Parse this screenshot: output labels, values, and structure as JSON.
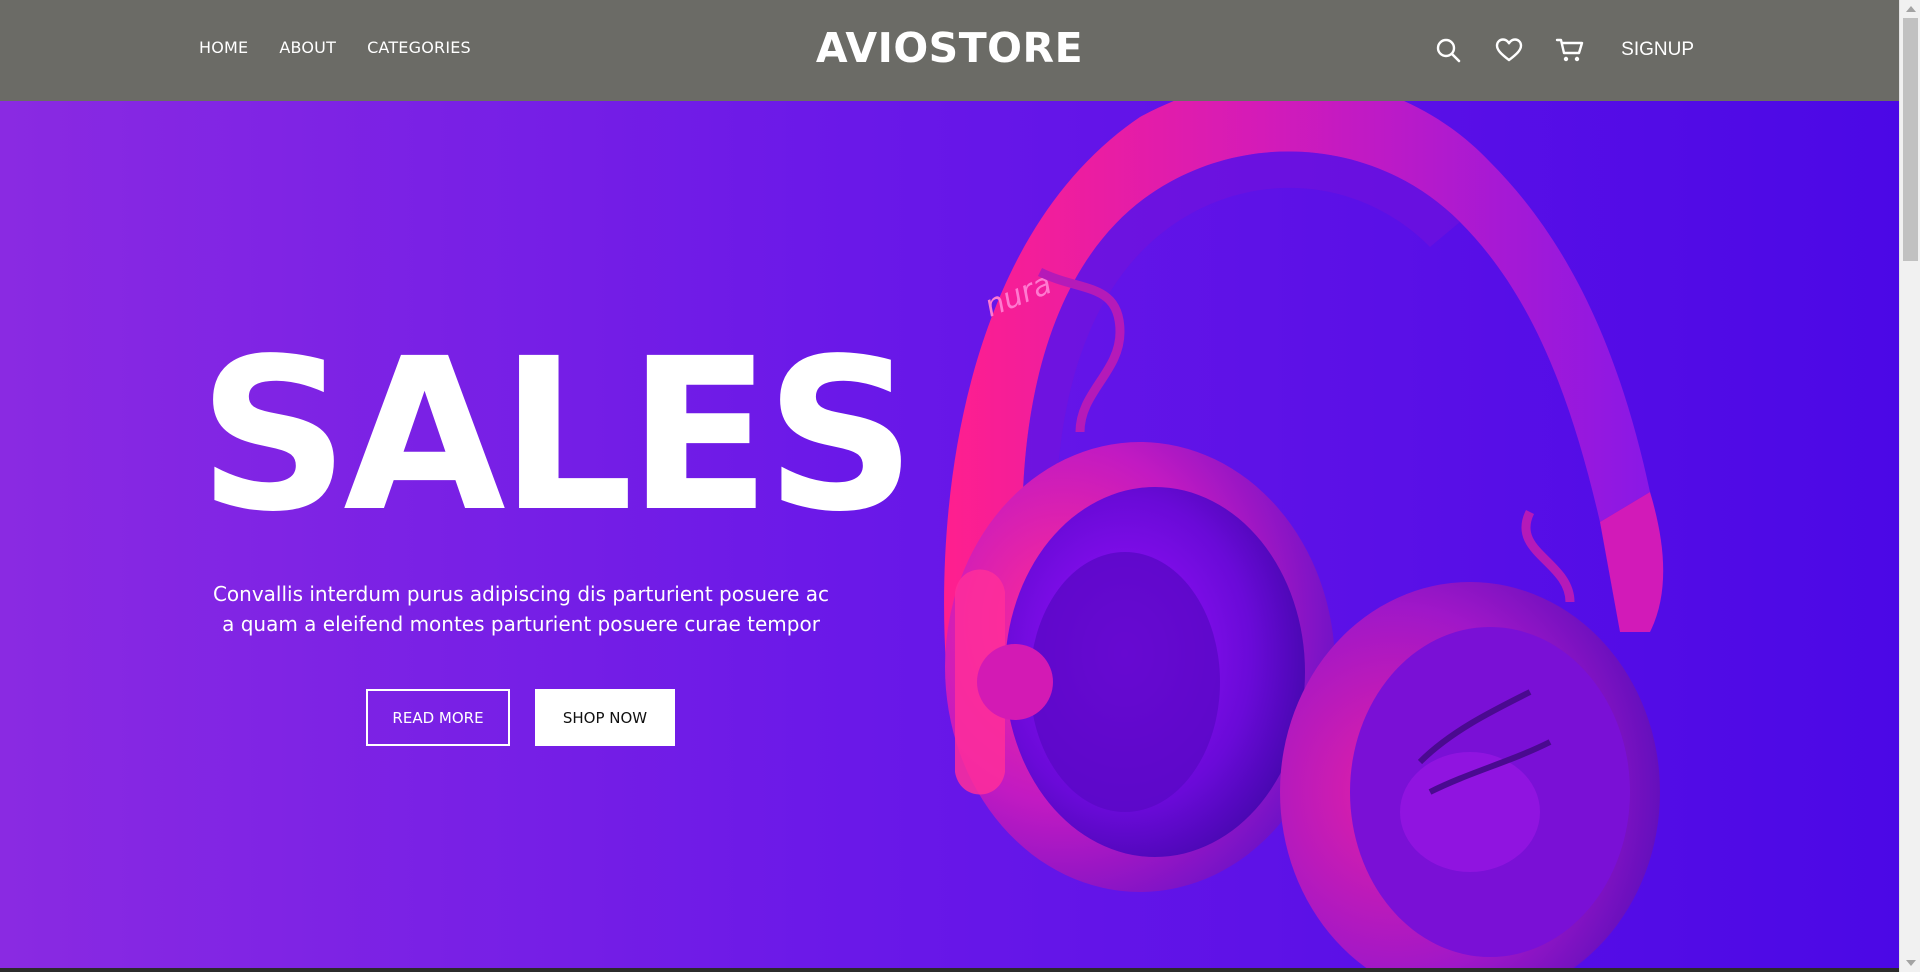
{
  "header": {
    "nav": [
      "HOME",
      "ABOUT",
      "CATEGORIES"
    ],
    "logo": "AVIOSTORE",
    "icons": [
      "search-icon",
      "heart-icon",
      "cart-icon"
    ],
    "signup": "SIGNUP",
    "background": "#6b6b66"
  },
  "hero": {
    "title": "SALES",
    "text": "Convallis interdum purus adipiscing dis parturient posuere ac a quam a eleifend montes parturient posuere curae tempor",
    "read_more": "READ MORE",
    "shop_now": "SHOP NOW",
    "product_brand": "nura",
    "gradient_start": "#8a2ae2",
    "gradient_end": "#4b08e6"
  }
}
